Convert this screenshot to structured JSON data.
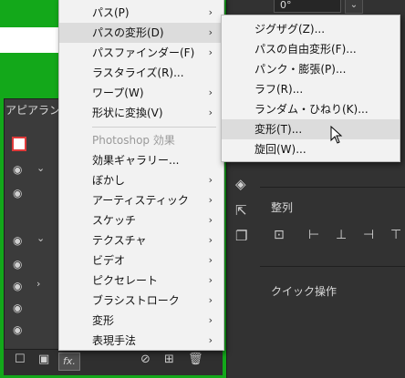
{
  "appearance_panel": {
    "title": "アピアランス",
    "bottom_icons": [
      "square-icon",
      "filled-square-icon",
      "fx-icon",
      "no-icon",
      "add-icon",
      "trash-icon"
    ],
    "fx_label": "fx."
  },
  "main_menu": {
    "items": [
      {
        "label": "パス(P)",
        "submenu": true
      },
      {
        "label": "パスの変形(D)",
        "submenu": true,
        "highlighted": true
      },
      {
        "label": "パスファインダー(F)",
        "submenu": true
      },
      {
        "label": "ラスタライズ(R)...",
        "submenu": false
      },
      {
        "label": "ワープ(W)",
        "submenu": true
      },
      {
        "label": "形状に変換(V)",
        "submenu": true
      }
    ],
    "section_header": "Photoshop 効果",
    "ps_items": [
      {
        "label": "効果ギャラリー...",
        "submenu": false
      },
      {
        "label": "ぼかし",
        "submenu": true
      },
      {
        "label": "アーティスティック",
        "submenu": true
      },
      {
        "label": "スケッチ",
        "submenu": true
      },
      {
        "label": "テクスチャ",
        "submenu": true
      },
      {
        "label": "ビデオ",
        "submenu": true
      },
      {
        "label": "ピクセレート",
        "submenu": true
      },
      {
        "label": "ブラシストローク",
        "submenu": true
      },
      {
        "label": "変形",
        "submenu": true
      },
      {
        "label": "表現手法",
        "submenu": true
      }
    ]
  },
  "submenu": {
    "items": [
      {
        "label": "ジグザグ(Z)..."
      },
      {
        "label": "パスの自由変形(F)..."
      },
      {
        "label": "パンク・膨張(P)..."
      },
      {
        "label": "ラフ(R)..."
      },
      {
        "label": "ランダム・ひねり(K)..."
      },
      {
        "label": "変形(T)...",
        "highlighted": true
      },
      {
        "label": "旋回(W)..."
      }
    ]
  },
  "right_panel": {
    "top_value": "0°",
    "align_label": "整列",
    "quick_actions_label": "クイック操作"
  }
}
